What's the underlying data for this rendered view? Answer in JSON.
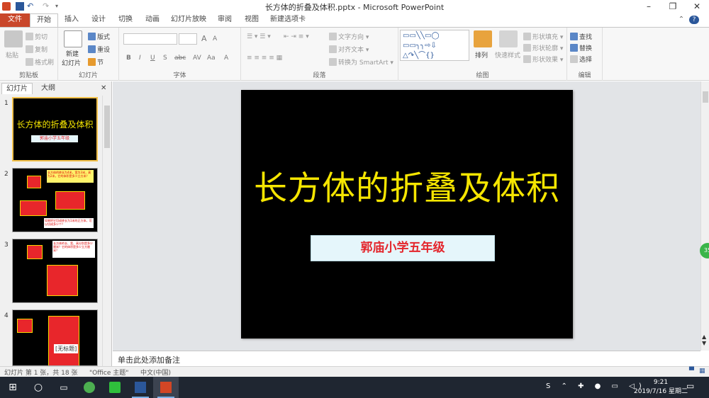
{
  "window": {
    "title": "长方体的折叠及体积.pptx - Microsoft PowerPoint",
    "help_glyph": "?"
  },
  "tabs": [
    {
      "label": "文件"
    },
    {
      "label": "开始"
    },
    {
      "label": "插入"
    },
    {
      "label": "设计"
    },
    {
      "label": "切换"
    },
    {
      "label": "动画"
    },
    {
      "label": "幻灯片放映"
    },
    {
      "label": "审阅"
    },
    {
      "label": "视图"
    },
    {
      "label": "新建选项卡"
    }
  ],
  "ribbon": {
    "clipboard": {
      "label": "剪贴板",
      "paste": "粘贴",
      "cut": "剪切",
      "copy": "复制",
      "format_painter": "格式刷"
    },
    "slides": {
      "label": "幻灯片",
      "new_slide_1": "新建",
      "new_slide_2": "幻灯片",
      "layout": "版式",
      "reset": "重设",
      "section": "节"
    },
    "font": {
      "label": "字体",
      "bold": "B",
      "italic": "I",
      "underline": "U",
      "strike": "abc",
      "shadow": "S",
      "size_up": "A",
      "size_down": "A",
      "spacing": "AV",
      "case": "Aa",
      "color": "A"
    },
    "paragraph": {
      "label": "段落",
      "text_direction": "文字方向",
      "align_text": "对齐文本",
      "smartart": "转换为 SmartArt"
    },
    "drawing": {
      "label": "绘图",
      "arrange": "排列",
      "quick_styles": "快速样式",
      "shape_fill": "形状填充",
      "shape_outline": "形状轮廓",
      "shape_effects": "形状效果"
    },
    "editing": {
      "label": "编辑",
      "find": "查找",
      "replace": "替换",
      "select": "选择"
    }
  },
  "panel": {
    "tab_slides": "幻灯片",
    "tab_outline": "大纲",
    "close": "✕",
    "thumbnails": [
      {
        "num": "1",
        "title": "长方体的折叠及体积",
        "sub": "郭庙小学五年级"
      },
      {
        "num": "2",
        "bubble_top": "长方体的棱长为4米，宽为3米，高为2米，它的体积是多少立方米？",
        "bubble_bottom": "如果把它切成棱长为1米的正方体，可以切成多少个？"
      },
      {
        "num": "3",
        "bubble": "长方体的长、宽、高分别是多少厘米？它的体积是多少立方厘米？"
      },
      {
        "num": "4",
        "label": "[无标题]"
      }
    ]
  },
  "slide": {
    "title": "长方体的折叠及体积",
    "subtitle": "郭庙小学五年级",
    "background": "#000000",
    "title_color": "#f5e500",
    "subtitle_color": "#e4262c"
  },
  "notes": {
    "placeholder": "单击此处添加备注"
  },
  "status": {
    "slide_info": "幻灯片 第 1 张，共 18 张",
    "theme": "\"Office 主题\"",
    "language": "中文(中国)"
  },
  "side_badge": "35",
  "taskbar": {
    "time": "9:21",
    "date": "2019/7/16 星期二"
  },
  "colors": {
    "file_tab": "#c9472b",
    "ribbon_bg": "#f7f7f7",
    "selected_thumb": "#f4c24b",
    "taskbar_bg": "#1f2631"
  }
}
